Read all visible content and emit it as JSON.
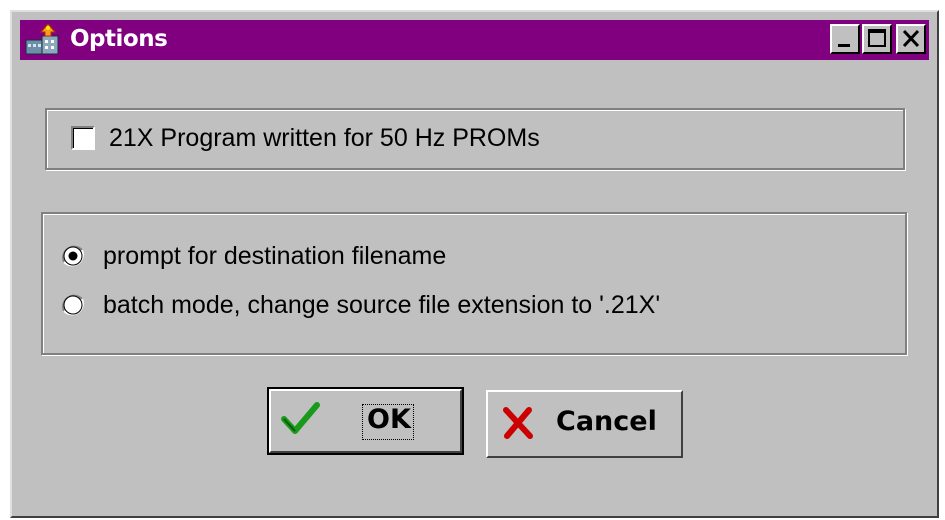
{
  "window": {
    "title": "Options",
    "controls": {
      "minimize_icon": "minimize-icon",
      "maximize_icon": "maximize-icon",
      "close_icon": "close-icon"
    }
  },
  "options": {
    "checkbox": {
      "label": "21X Program written for 50 Hz PROMs",
      "checked": false
    },
    "radio_group": [
      {
        "label": "prompt for destination filename",
        "selected": true
      },
      {
        "label": "batch mode, change source file extension to '.21X'",
        "selected": false
      }
    ]
  },
  "buttons": {
    "ok": {
      "label": "OK",
      "icon": "checkmark-icon",
      "default": true
    },
    "cancel": {
      "label": "Cancel",
      "icon": "x-icon"
    }
  },
  "colors": {
    "titlebar": "#800080",
    "face": "#c0c0c0",
    "check_green": "#1a9a1a",
    "cancel_red": "#cc0000"
  }
}
